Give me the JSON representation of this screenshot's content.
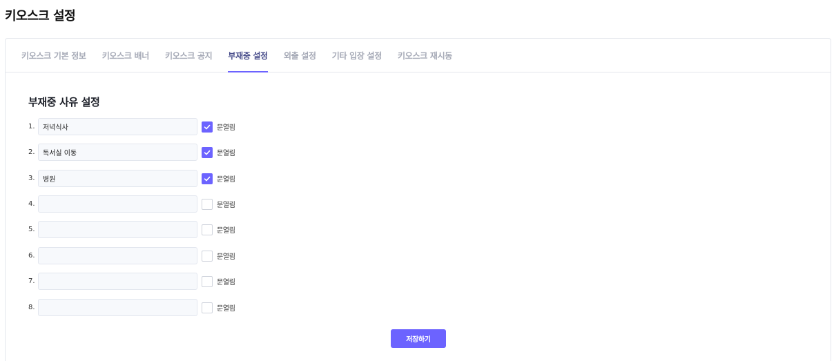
{
  "page": {
    "title": "키오스크 설정"
  },
  "tabs": [
    {
      "label": "키오스크 기본 정보",
      "active": false
    },
    {
      "label": "키오스크 배너",
      "active": false
    },
    {
      "label": "키오스크 공지",
      "active": false
    },
    {
      "label": "부재중 설정",
      "active": true
    },
    {
      "label": "외출 설정",
      "active": false
    },
    {
      "label": "기타 입장 설정",
      "active": false
    },
    {
      "label": "키오스크 재시동",
      "active": false
    }
  ],
  "section": {
    "title": "부재중 사유 설정"
  },
  "checkbox_label": "문열림",
  "reasons": [
    {
      "num": "1.",
      "value": "저녁식사",
      "checked": true
    },
    {
      "num": "2.",
      "value": "독서실 이동",
      "checked": true
    },
    {
      "num": "3.",
      "value": "병원",
      "checked": true
    },
    {
      "num": "4.",
      "value": "",
      "checked": false
    },
    {
      "num": "5.",
      "value": "",
      "checked": false
    },
    {
      "num": "6.",
      "value": "",
      "checked": false
    },
    {
      "num": "7.",
      "value": "",
      "checked": false
    },
    {
      "num": "8.",
      "value": "",
      "checked": false
    }
  ],
  "actions": {
    "save_label": "저장하기"
  },
  "colors": {
    "accent": "#6c63ff",
    "active_tab_text": "#4a4f8c",
    "inactive_tab_text": "#a5a9b6"
  }
}
